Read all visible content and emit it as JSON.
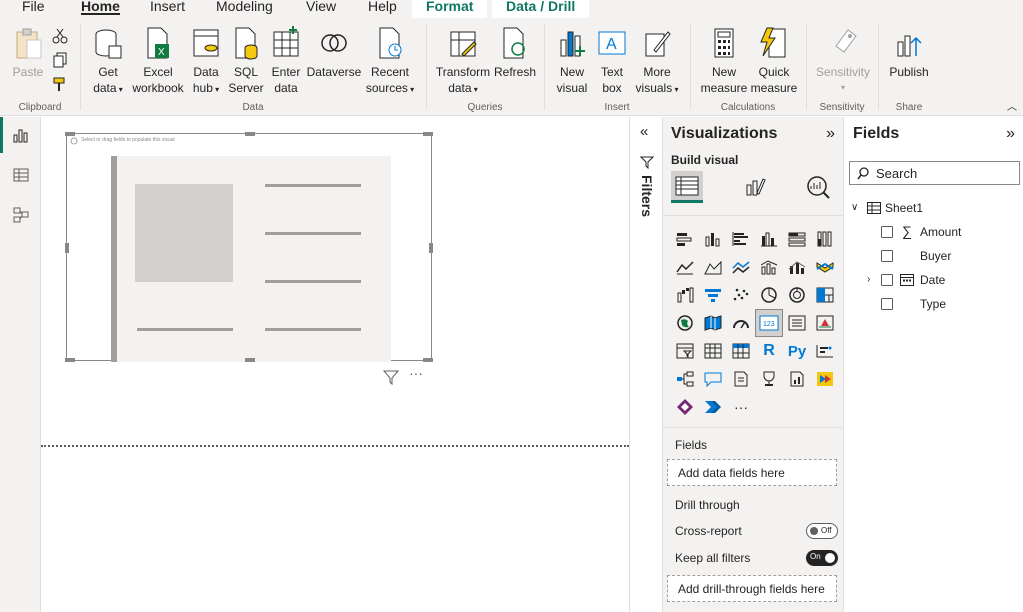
{
  "menu": {
    "tabs": [
      {
        "label": "File"
      },
      {
        "label": "Home"
      },
      {
        "label": "Insert"
      },
      {
        "label": "Modeling"
      },
      {
        "label": "View"
      },
      {
        "label": "Help"
      },
      {
        "label": "Format"
      },
      {
        "label": "Data / Drill"
      }
    ],
    "active_tab": "Home"
  },
  "ribbon": {
    "groups": {
      "clipboard": "Clipboard",
      "data": "Data",
      "queries": "Queries",
      "insert": "Insert",
      "calculations": "Calculations",
      "sensitivity": "Sensitivity",
      "share": "Share"
    },
    "buttons": {
      "paste": "Paste",
      "get_data_1": "Get",
      "get_data_2": "data",
      "excel_1": "Excel",
      "excel_2": "workbook",
      "datahub_1": "Data",
      "datahub_2": "hub",
      "sql_1": "SQL",
      "sql_2": "Server",
      "enter_1": "Enter",
      "enter_2": "data",
      "dataverse": "Dataverse",
      "recent_1": "Recent",
      "recent_2": "sources",
      "transform_1": "Transform",
      "transform_2": "data",
      "refresh": "Refresh",
      "newvisual_1": "New",
      "newvisual_2": "visual",
      "textbox_1": "Text",
      "textbox_2": "box",
      "morevisuals_1": "More",
      "morevisuals_2": "visuals",
      "newmeasure_1": "New",
      "newmeasure_2": "measure",
      "quickmeasure_1": "Quick",
      "quickmeasure_2": "measure",
      "sensitivity": "Sensitivity",
      "publish": "Publish"
    }
  },
  "canvas": {
    "visual_hint": "Select or drag fields to populate this visual"
  },
  "filters": {
    "label": "Filters"
  },
  "visualizations": {
    "title": "Visualizations",
    "build_visual": "Build visual",
    "fields_label": "Fields",
    "fields_placeholder": "Add data fields here",
    "drill_through": "Drill through",
    "cross_report": "Cross-report",
    "cross_report_state": "Off",
    "keep_all_filters": "Keep all filters",
    "keep_all_filters_state": "On",
    "drillthrough_placeholder": "Add drill-through fields here",
    "r_label": "R",
    "py_label": "Py",
    "card_label": "123",
    "more": "···"
  },
  "fields": {
    "title": "Fields",
    "search_placeholder": "Search",
    "table": {
      "name": "Sheet1",
      "columns": [
        {
          "name": "Amount",
          "icon": "sigma-icon"
        },
        {
          "name": "Buyer",
          "icon": ""
        },
        {
          "name": "Date",
          "icon": "calendar-icon"
        },
        {
          "name": "Type",
          "icon": ""
        }
      ]
    }
  }
}
